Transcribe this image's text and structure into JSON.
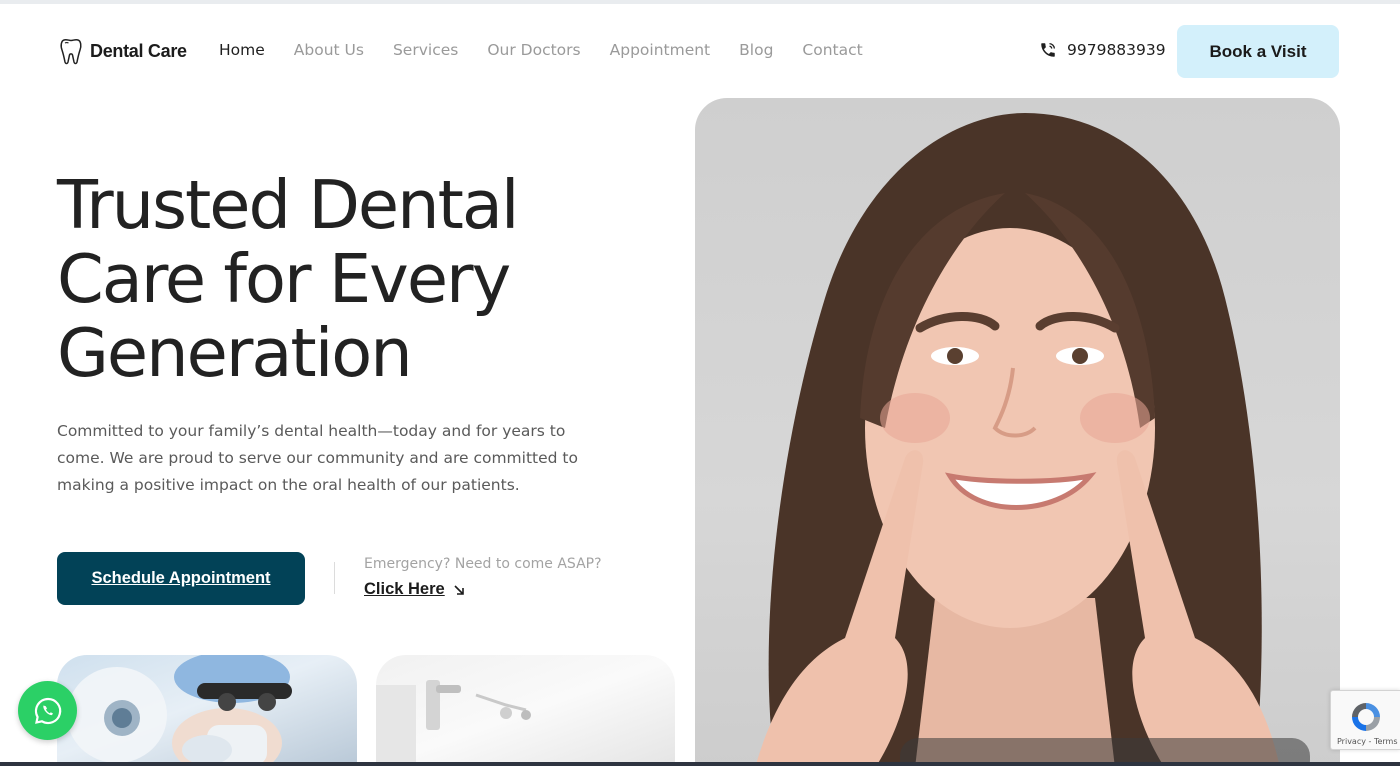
{
  "brand": {
    "name": "Dental Care",
    "icon": "tooth-icon"
  },
  "nav": {
    "items": [
      {
        "label": "Home",
        "active": true
      },
      {
        "label": "About Us",
        "active": false
      },
      {
        "label": "Services",
        "active": false
      },
      {
        "label": "Our Doctors",
        "active": false
      },
      {
        "label": "Appointment",
        "active": false
      },
      {
        "label": "Blog",
        "active": false
      },
      {
        "label": "Contact",
        "active": false
      }
    ]
  },
  "header": {
    "phone": "9979883939",
    "phone_icon": "phone-icon",
    "book_label": "Book a Visit"
  },
  "hero": {
    "title_lines": [
      "Trusted Dental",
      "Care for Every",
      "Generation"
    ],
    "description": "Committed to your family’s dental health—today and for years to come. We are proud to serve our community and are committed to making a positive impact on the oral health of our patients.",
    "schedule_label": "Schedule Appointment",
    "emergency_text": "Emergency? Need to come ASAP?",
    "click_here_label": "Click Here",
    "image": "smiling-woman-photo"
  },
  "cards": [
    {
      "image": "dentist-with-loupes-photo"
    },
    {
      "image": "dental-clinic-room-photo"
    }
  ],
  "widgets": {
    "whatsapp_icon": "whatsapp-icon",
    "recaptcha_text": "Privacy - Terms"
  },
  "colors": {
    "primary": "#024257",
    "accent_light": "#d3f0fb",
    "whatsapp": "#2bd066",
    "nav_inactive": "#9a9a9a"
  }
}
